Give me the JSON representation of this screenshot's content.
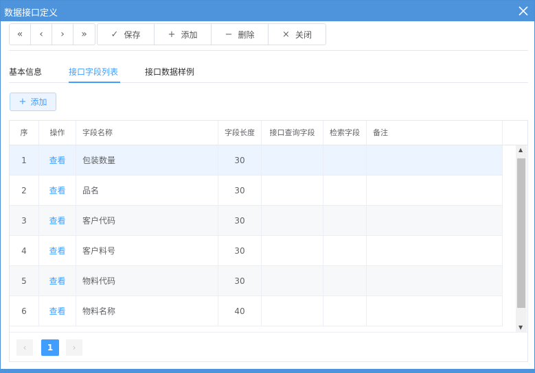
{
  "window": {
    "title": "数据接口定义"
  },
  "toolbar": {
    "nav": [
      {
        "name": "first-page-button",
        "icon": "double-chevron-left-icon",
        "glyph": "«"
      },
      {
        "name": "prev-button",
        "icon": "chevron-left-icon",
        "glyph": "‹"
      },
      {
        "name": "next-button",
        "icon": "chevron-right-icon",
        "glyph": "›"
      },
      {
        "name": "last-page-button",
        "icon": "double-chevron-right-icon",
        "glyph": "»"
      }
    ],
    "actions": [
      {
        "name": "save-button",
        "label": "保存",
        "icon": "check-icon",
        "glyph": "✓"
      },
      {
        "name": "add-button",
        "label": "添加",
        "icon": "plus-icon",
        "glyph": "+"
      },
      {
        "name": "delete-button",
        "label": "删除",
        "icon": "minus-icon",
        "glyph": "−"
      },
      {
        "name": "close-button",
        "label": "关闭",
        "icon": "close-icon",
        "glyph": "×"
      }
    ]
  },
  "tabs": [
    {
      "label": "基本信息",
      "active": false
    },
    {
      "label": "接口字段列表",
      "active": true
    },
    {
      "label": "接口数据样例",
      "active": false
    }
  ],
  "add_button": {
    "label": "添加",
    "icon": "plus-icon"
  },
  "table": {
    "columns": [
      "序",
      "操作",
      "字段名称",
      "字段长度",
      "接口查询字段",
      "检索字段",
      "备注"
    ],
    "rows": [
      {
        "index": "1",
        "action": "查看",
        "field_name": "包装数量",
        "length": "30",
        "query_field": "",
        "search_field": "",
        "remark": ""
      },
      {
        "index": "2",
        "action": "查看",
        "field_name": "品名",
        "length": "30",
        "query_field": "",
        "search_field": "",
        "remark": ""
      },
      {
        "index": "3",
        "action": "查看",
        "field_name": "客户代码",
        "length": "30",
        "query_field": "",
        "search_field": "",
        "remark": ""
      },
      {
        "index": "4",
        "action": "查看",
        "field_name": "客户料号",
        "length": "30",
        "query_field": "",
        "search_field": "",
        "remark": ""
      },
      {
        "index": "5",
        "action": "查看",
        "field_name": "物料代码",
        "length": "30",
        "query_field": "",
        "search_field": "",
        "remark": ""
      },
      {
        "index": "6",
        "action": "查看",
        "field_name": "物料名称",
        "length": "40",
        "query_field": "",
        "search_field": "",
        "remark": ""
      }
    ],
    "selected_row": 0
  },
  "pager": {
    "current_page": "1"
  },
  "colors": {
    "accent": "#409eff",
    "titlebar": "#4d94dc"
  }
}
